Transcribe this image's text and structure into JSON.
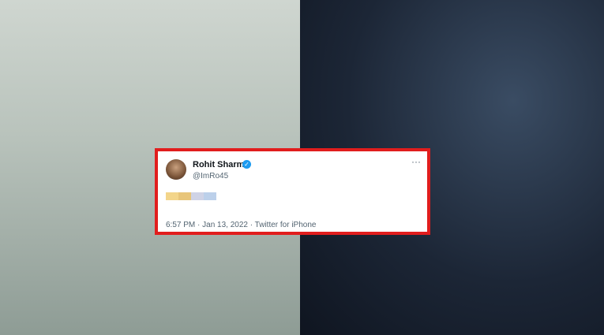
{
  "tweet": {
    "name": "Rohit Sharma",
    "handle": "@ImRo45",
    "timestamp": "6:57 PM · Jan 13, 2022 · Twitter for iPhone",
    "more_icon": "more-horizontal-icon",
    "verified_icon": "verified-badge-icon",
    "frame_color": "#e11d1d"
  }
}
